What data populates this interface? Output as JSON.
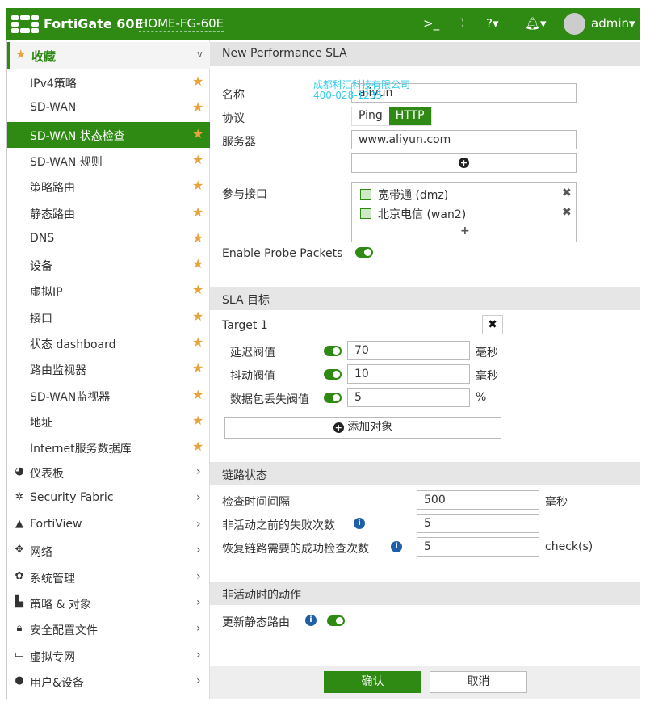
{
  "header": {
    "brand": "FortiGate 60E",
    "hostname": "HOME-FG-60E",
    "user": "admin",
    "icons": [
      "cli-console-icon",
      "fullscreen-icon",
      "help-icon",
      "bell-icon",
      "avatar"
    ]
  },
  "sidebar": {
    "favorites": {
      "label": "收藏",
      "items": [
        {
          "label": "IPv4策略"
        },
        {
          "label": "SD-WAN"
        },
        {
          "label": "SD-WAN 状态检查",
          "active": true
        },
        {
          "label": "SD-WAN 规则"
        },
        {
          "label": "策略路由"
        },
        {
          "label": "静态路由"
        },
        {
          "label": "DNS"
        },
        {
          "label": "设备"
        },
        {
          "label": "虚拟IP"
        },
        {
          "label": "接口"
        },
        {
          "label": "状态 dashboard"
        },
        {
          "label": "路由监视器"
        },
        {
          "label": "SD-WAN监视器"
        },
        {
          "label": "地址"
        },
        {
          "label": "Internet服务数据库"
        }
      ]
    },
    "menus": [
      {
        "label": "仪表板",
        "icon": "dashboard-icon"
      },
      {
        "label": "Security Fabric",
        "icon": "security-fabric-icon"
      },
      {
        "label": "FortiView",
        "icon": "area-chart-icon"
      },
      {
        "label": "网络",
        "icon": "arrows-icon"
      },
      {
        "label": "系统管理",
        "icon": "gear-icon"
      },
      {
        "label": "策略 & 对象",
        "icon": "policy-icon"
      },
      {
        "label": "安全配置文件",
        "icon": "lock-icon"
      },
      {
        "label": "虚拟专网",
        "icon": "laptop-icon"
      },
      {
        "label": "用户&设备",
        "icon": "user-icon"
      }
    ]
  },
  "form": {
    "title": "New Performance SLA",
    "name_label": "名称",
    "name_value": "aliyun",
    "protocol_label": "协议",
    "protocol_options": [
      "Ping",
      "HTTP"
    ],
    "protocol_selected": "HTTP",
    "server_label": "服务器",
    "server_value": "www.aliyun.com",
    "interfaces_label": "参与接口",
    "interfaces": [
      "宽带通 (dmz)",
      "北京电信 (wan2)"
    ],
    "probe_label": "Enable Probe Packets",
    "probe_enabled": true
  },
  "sla": {
    "title": "SLA 目标",
    "target": "Target 1",
    "rows": [
      {
        "label": "延迟阀值",
        "value": "70",
        "unit": "毫秒",
        "enabled": true
      },
      {
        "label": "抖动阀值",
        "value": "10",
        "unit": "毫秒",
        "enabled": true
      },
      {
        "label": "数据包丢失阀值",
        "value": "5",
        "unit": "%",
        "enabled": true
      }
    ],
    "add_label": "添加对象"
  },
  "link": {
    "title": "链路状态",
    "rows": [
      {
        "label": "检查时间间隔",
        "value": "500",
        "unit": "毫秒"
      },
      {
        "label": "非活动之前的失败次数",
        "value": "5",
        "unit": ""
      },
      {
        "label": "恢复链路需要的成功检查次数",
        "value": "5",
        "unit": "check(s)"
      }
    ]
  },
  "inactive": {
    "title": "非活动时的动作",
    "update_static_label": "更新静态路由",
    "update_static_enabled": true
  },
  "footer": {
    "ok": "确认",
    "cancel": "取消"
  },
  "watermark": {
    "line1": "成都科汇科技有限公司",
    "line2": "400-028-1235"
  },
  "colors": {
    "brand": "#2e8a13",
    "favorite_star": "#e8a33d",
    "info": "#1f5fa8"
  }
}
